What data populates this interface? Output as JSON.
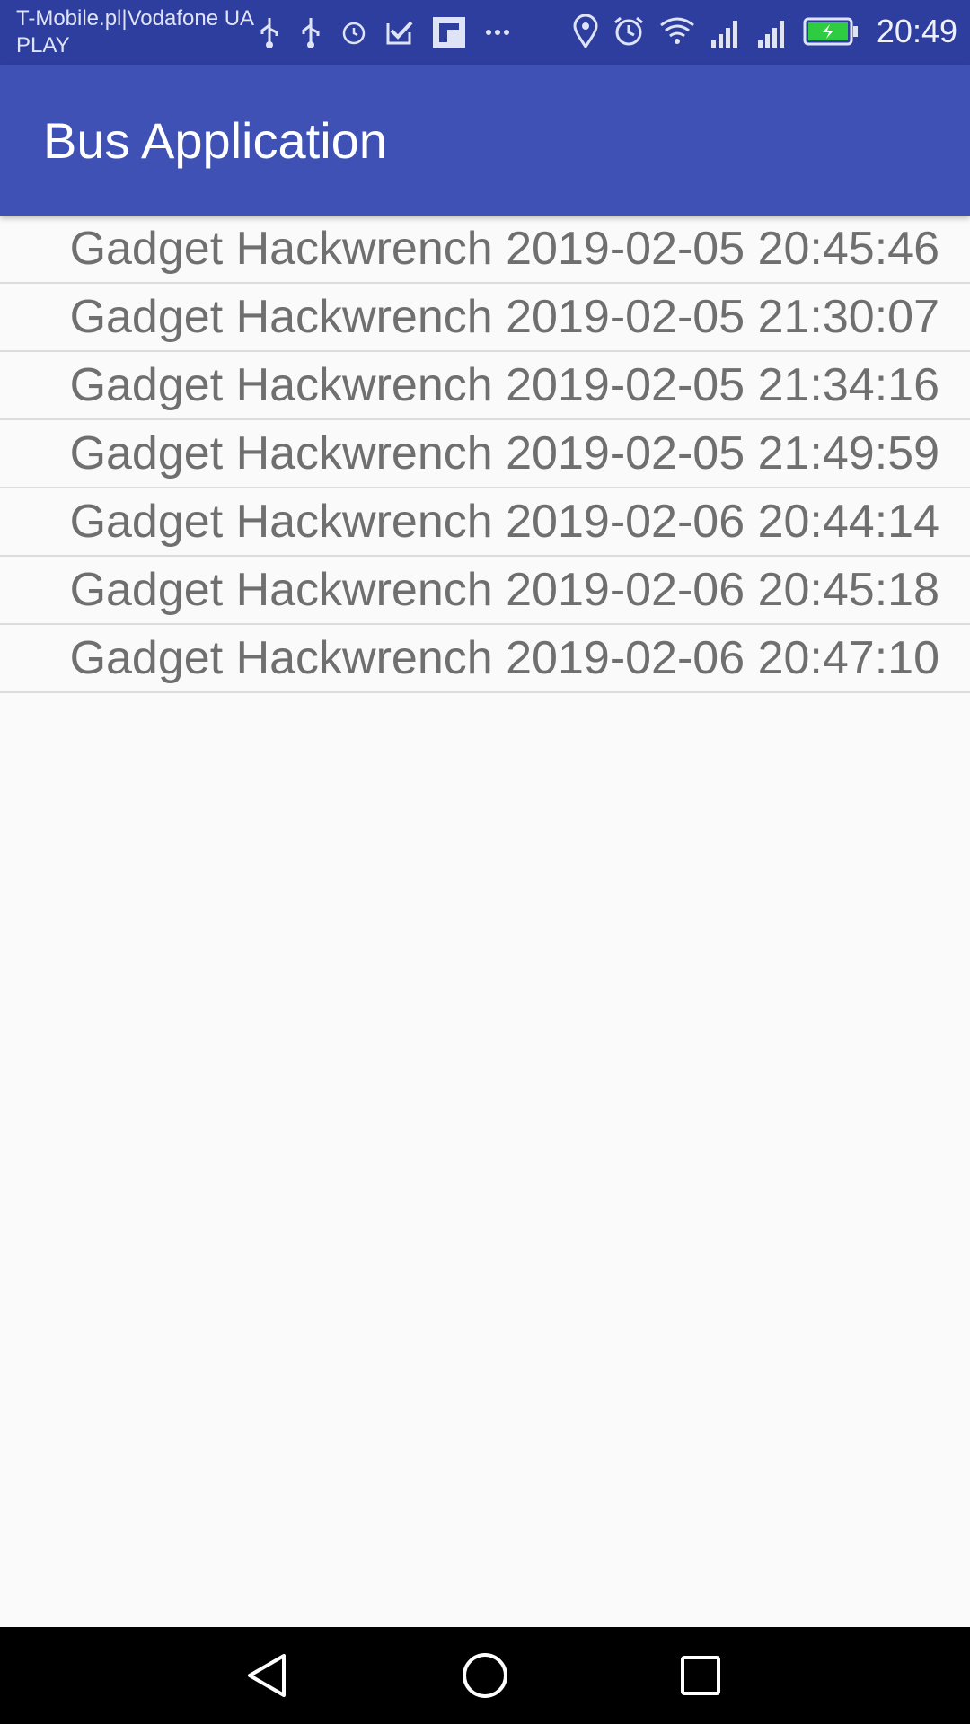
{
  "status_bar": {
    "carrier_line1": "T-Mobile.pl|Vodafone UA",
    "carrier_line2": "PLAY",
    "time": "20:49",
    "left_icons": [
      "usb-icon",
      "usb-icon",
      "alarm-icon",
      "checkbox-icon",
      "flipboard-icon",
      "more-dots-icon"
    ],
    "right_icons": [
      "location-icon",
      "alarm-icon",
      "wifi-icon",
      "signal-icon",
      "signal-icon",
      "battery-charging-icon"
    ],
    "battery_color": "#2ecc40"
  },
  "app_bar": {
    "title": "Bus Application",
    "color": "#3f51b5"
  },
  "list": {
    "items": [
      {
        "text": "Gadget Hackwrench 2019-02-05 20:45:46"
      },
      {
        "text": "Gadget Hackwrench 2019-02-05 21:30:07"
      },
      {
        "text": "Gadget Hackwrench 2019-02-05 21:34:16"
      },
      {
        "text": "Gadget Hackwrench 2019-02-05 21:49:59"
      },
      {
        "text": "Gadget Hackwrench 2019-02-06 20:44:14"
      },
      {
        "text": "Gadget Hackwrench 2019-02-06 20:45:18"
      },
      {
        "text": "Gadget Hackwrench 2019-02-06 20:47:10"
      }
    ]
  },
  "nav_bar": {
    "buttons": [
      "back-icon",
      "home-icon",
      "recent-apps-icon"
    ]
  }
}
